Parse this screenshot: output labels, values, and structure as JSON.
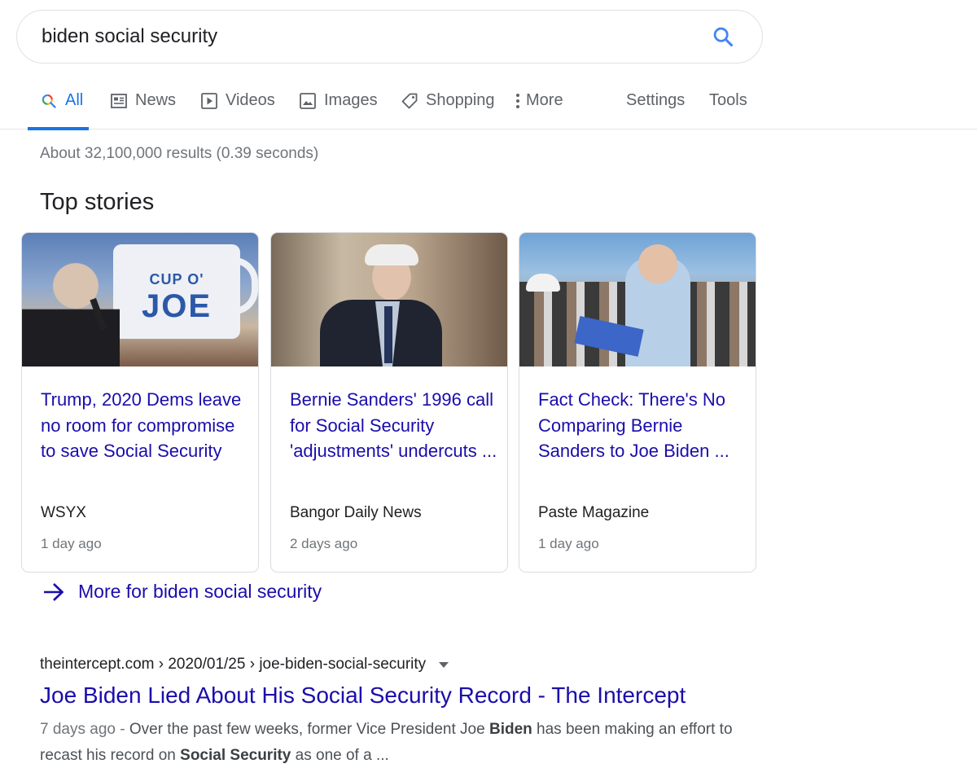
{
  "search": {
    "query": "biden social security"
  },
  "tabs": [
    {
      "label": "All",
      "icon": "search-icon"
    },
    {
      "label": "News",
      "icon": "news-icon"
    },
    {
      "label": "Videos",
      "icon": "play-icon"
    },
    {
      "label": "Images",
      "icon": "image-icon"
    },
    {
      "label": "Shopping",
      "icon": "tag-icon"
    },
    {
      "label": "More",
      "icon": "more-vert-icon"
    }
  ],
  "tools": {
    "settings": "Settings",
    "tools": "Tools"
  },
  "result_stats": "About 32,100,000 results (0.39 seconds)",
  "top_stories": {
    "title": "Top stories",
    "cards": [
      {
        "headline": "Trump, 2020 Dems leave no room for compromise to save Social Security",
        "source": "WSYX",
        "age": "1 day ago",
        "thumb_text": [
          "CUP O'",
          "JOE"
        ]
      },
      {
        "headline": "Bernie Sanders' 1996 call for Social Security 'adjustments' undercuts ...",
        "source": "Bangor Daily News",
        "age": "2 days ago"
      },
      {
        "headline": "Fact Check: There's No Comparing Bernie Sanders to Joe Biden ...",
        "source": "Paste Magazine",
        "age": "1 day ago"
      }
    ],
    "more": "More for biden social security"
  },
  "result": {
    "cite": "theintercept.com › 2020/01/25 › joe-biden-social-security",
    "title": "Joe Biden Lied About His Social Security Record - The Intercept",
    "date": "7 days ago - ",
    "snippet_1": "Over the past few weeks, former Vice President Joe ",
    "snippet_b1": "Biden",
    "snippet_2": " has been making an effort to recast his record on ",
    "snippet_b2": "Social Security",
    "snippet_3": " as one of a ..."
  },
  "colors": {
    "link": "#1a0dab",
    "accent": "#1a73e8",
    "muted": "#70757a"
  }
}
